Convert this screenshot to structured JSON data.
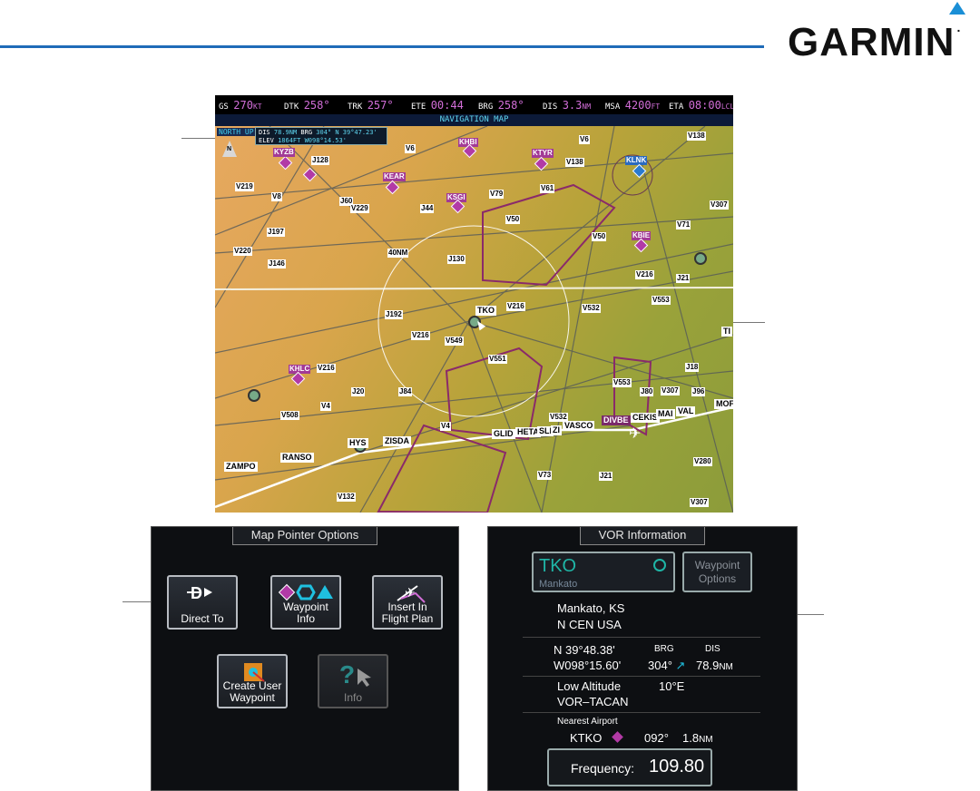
{
  "header": {
    "logo": "GARMIN"
  },
  "status_bar": {
    "gs": {
      "label": "GS",
      "value": "270",
      "unit": "KT"
    },
    "dtk": {
      "label": "DTK",
      "value": "258°"
    },
    "trk": {
      "label": "TRK",
      "value": "257°"
    },
    "ete": {
      "label": "ETE",
      "value": "00:44"
    },
    "brg": {
      "label": "BRG",
      "value": "258°"
    },
    "dis": {
      "label": "DIS",
      "value": "3.3",
      "unit": "NM"
    },
    "msa": {
      "label": "MSA",
      "value": "4200",
      "unit": "FT"
    },
    "eta": {
      "label": "ETA",
      "value": "08:00",
      "unit": "LCL"
    }
  },
  "map": {
    "title": "NAVIGATION MAP",
    "orientation": "NORTH UP",
    "north_label": "N",
    "range_label": "40NM",
    "pointer_info": {
      "dis_label": "DIS",
      "dis_value": "78.9NM",
      "brg_label": "BRG",
      "brg_value": "304°",
      "lat": "N 39°47.23'",
      "elev_label": "ELEV",
      "elev_value": "1864FT",
      "lon": "W098°14.53'"
    },
    "airways": [
      "V6",
      "V6",
      "V138",
      "V138",
      "V219",
      "J128",
      "V220",
      "V8",
      "J60",
      "V229",
      "J44",
      "V79",
      "V61",
      "V50",
      "V50",
      "V71",
      "V307",
      "J197",
      "V220",
      "J146",
      "J130",
      "V216",
      "J21",
      "V553",
      "J192",
      "V216",
      "V532",
      "V216",
      "V549",
      "V551",
      "V553",
      "J18",
      "J80",
      "V307",
      "J96",
      "V216",
      "J84",
      "V508",
      "V4",
      "V4",
      "V532",
      "V73",
      "J21",
      "V280",
      "V307",
      "V132",
      "J20"
    ],
    "waypoints": [
      "TKO",
      "HYS",
      "ZISDA",
      "RANSO",
      "ZAMPO",
      "GLID",
      "HETA",
      "SLI",
      "ZI",
      "VASCO",
      "DIVBE",
      "CEKIS",
      "MAI",
      "VAL",
      "MOF",
      "TI"
    ],
    "airports": [
      "KYZB",
      "KHBI",
      "KTYR",
      "KLNK",
      "KEAR",
      "KSGI",
      "KBIE",
      "KHLC"
    ]
  },
  "map_pointer_options": {
    "title": "Map Pointer Options",
    "buttons": [
      {
        "label1": "Direct To",
        "label2": "",
        "icon": "direct-to-icon"
      },
      {
        "label1": "Waypoint",
        "label2": "Info",
        "icon": "waypoint-info-icon"
      },
      {
        "label1": "Insert In",
        "label2": "Flight Plan",
        "icon": "insert-flight-plan-icon"
      },
      {
        "label1": "Create User",
        "label2": "Waypoint",
        "icon": "create-user-waypoint-icon"
      },
      {
        "label1": "Info",
        "label2": "",
        "icon": "info-icon"
      }
    ]
  },
  "vor_information": {
    "title": "VOR Information",
    "ident": "TKO",
    "name": "Mankato",
    "waypoint_options": [
      "Waypoint",
      "Options"
    ],
    "city": "Mankato, KS",
    "region": "N CEN USA",
    "lat": "N 39°48.38'",
    "lon": "W098°15.60'",
    "brg_label": "BRG",
    "brg_value": "304°",
    "dis_label": "DIS",
    "dis_value": "78.9",
    "dis_unit": "NM",
    "class": "Low Altitude",
    "type": "VOR–TACAN",
    "mag_var": "10°E",
    "nearest_airport_label": "Nearest Airport",
    "nearest_airport": "KTKO",
    "nearest_brg": "092°",
    "nearest_dis": "1.8",
    "nearest_unit": "NM",
    "frequency_label": "Frequency:",
    "frequency": "109.80"
  },
  "colors": {
    "accent": "#1f6bb8",
    "magenta": "#d26ed8",
    "cyan": "#5fd6f0",
    "teal": "#1fb5a6"
  }
}
